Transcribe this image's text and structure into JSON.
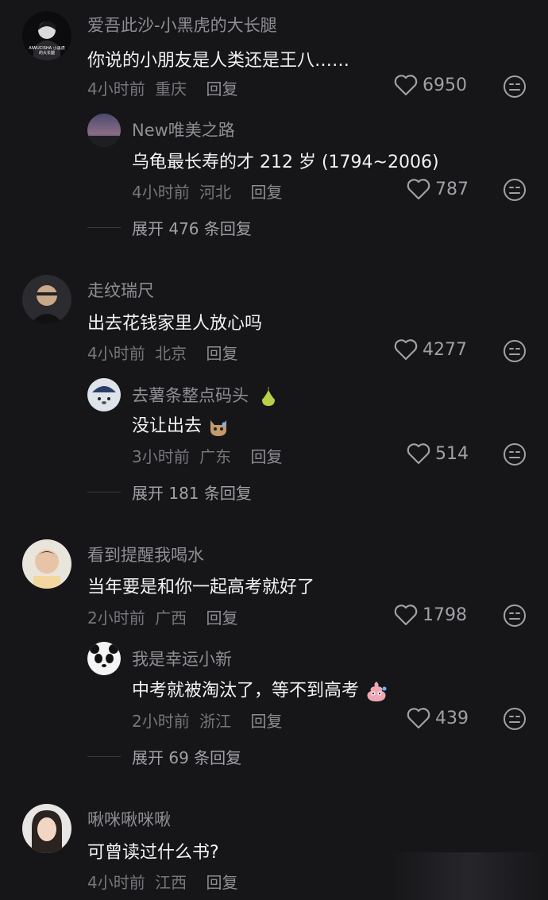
{
  "comments": [
    {
      "user": "爱吾此沙-小黑虎的大长腿",
      "text": "你说的小朋友是人类还是王八……",
      "time": "4小时前",
      "location": "重庆",
      "reply_label": "回复",
      "likes": "6950",
      "avatar_text": "AIWUCISHA 小黑虎的大长腿",
      "replies": [
        {
          "user": "New唯美之路",
          "text": "乌龟最长寿的才 212 岁 (1794~2006)",
          "time": "4小时前",
          "location": "河北",
          "reply_label": "回复",
          "likes": "787"
        }
      ],
      "expand": "展开 476 条回复"
    },
    {
      "user": "走纹瑞尺",
      "text": "出去花钱家里人放心吗",
      "time": "4小时前",
      "location": "北京",
      "reply_label": "回复",
      "likes": "4277",
      "replies": [
        {
          "user": "去薯条整点码头",
          "text": "没让出去",
          "time": "3小时前",
          "location": "广东",
          "reply_label": "回复",
          "likes": "514"
        }
      ],
      "expand": "展开 181 条回复"
    },
    {
      "user": "看到提醒我喝水",
      "text": "当年要是和你一起高考就好了",
      "time": "2小时前",
      "location": "广西",
      "reply_label": "回复",
      "likes": "1798",
      "replies": [
        {
          "user": "我是幸运小新",
          "text": "中考就被淘汰了，等不到高考",
          "time": "2小时前",
          "location": "浙江",
          "reply_label": "回复",
          "likes": "439"
        }
      ],
      "expand": "展开 69 条回复"
    },
    {
      "user": "啾咪啾咪啾",
      "text": "可曾读过什么书?",
      "time": "4小时前",
      "location": "江西",
      "reply_label": "回复"
    }
  ],
  "icons": {
    "like": "heart-outline-icon",
    "dislike": "neutral-face-icon"
  },
  "colors": {
    "background": "#161619",
    "username": "#8e8e93",
    "text": "#f2f2f4",
    "meta": "#76767b"
  }
}
